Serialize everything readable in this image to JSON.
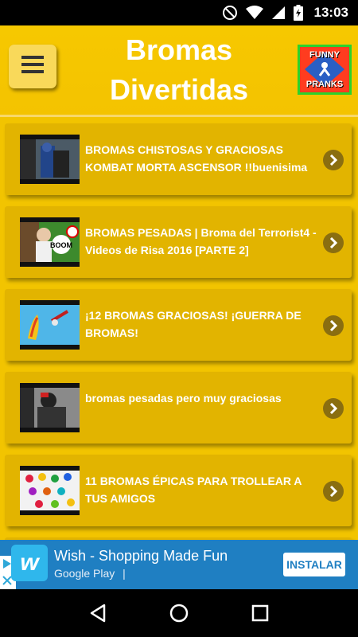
{
  "status_bar": {
    "time": "13:03"
  },
  "header": {
    "title_line1": "Bromas",
    "title_line2": "Divertidas",
    "logo_top": "FUNNY",
    "logo_bottom": "PRANKS"
  },
  "items": [
    {
      "title": "BROMAS CHISTOSAS Y GRACIOSAS KOMBAT MORTA ASCENSOR !!buenisima"
    },
    {
      "title": "BROMAS PESADAS | Broma del Terrorist4 - Videos de Risa 2016 [PARTE 2]"
    },
    {
      "title": "¡12 BROMAS GRACIOSAS! ¡GUERRA DE BROMAS!"
    },
    {
      "title": "bromas pesadas pero muy graciosas"
    },
    {
      "title": "11 BROMAS ÉPICAS PARA TROLLEAR A TUS AMIGOS"
    }
  ],
  "ad": {
    "title": "Wish - Shopping Made Fun",
    "subtitle": "Google Play",
    "subtitle_sep": "|",
    "logo_letter": "w",
    "install_label": "INSTALAR"
  },
  "colors": {
    "background": "#f2c400",
    "card": "#e2b400",
    "chevron": "#8a6e10",
    "ad_background": "#1f7fc2"
  }
}
